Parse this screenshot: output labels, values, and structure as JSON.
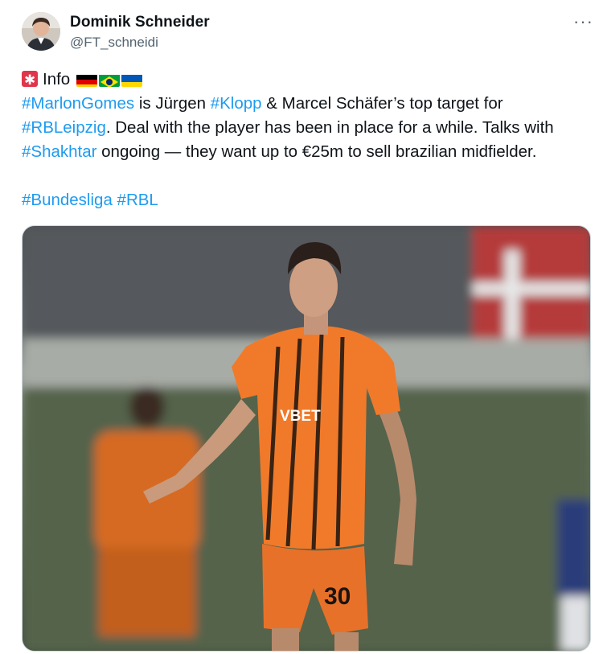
{
  "author": {
    "name": "Dominik Schneider",
    "handle": "@FT_schneidi"
  },
  "more_label": "···",
  "tweet": {
    "line1_info": "Info",
    "flags": [
      "germany-flag",
      "brazil-flag",
      "ukraine-flag"
    ],
    "tag_marlon": "#MarlonGomes",
    "text_a": " is Jürgen ",
    "tag_klopp": "#Klopp",
    "text_b": " & Marcel Schäfer’s top target for ",
    "tag_rbleipzig": "#RBLeipzig",
    "text_c": ". Deal with the player has been in place for a while. Talks with ",
    "tag_shakhtar": "#Shakhtar",
    "text_d": " ongoing — they want up to €25m to sell brazilian midfielder.",
    "tag_bundesliga": "#Bundesliga",
    "tag_rbl": "#RBL"
  },
  "photo": {
    "sponsor_text": "VBET",
    "shirt_number": "30"
  },
  "colors": {
    "link": "#1d9bf0",
    "text": "#0f1419",
    "secondary": "#536471",
    "kit_orange": "#f07a2a"
  }
}
